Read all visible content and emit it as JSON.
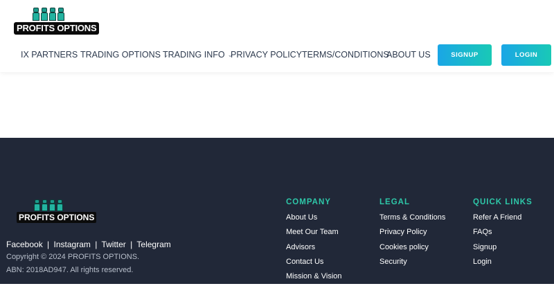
{
  "header": {
    "logo_text": "PROFITS OPTIONS",
    "nav": [
      {
        "label": "IX PARTNERS",
        "has_dropdown": false
      },
      {
        "label": "TRADING OPTIONS",
        "has_dropdown": true
      },
      {
        "label": "TRADING INFO",
        "has_dropdown": true
      },
      {
        "label": "PRIVACY POLICY",
        "has_dropdown": false
      },
      {
        "label": "TERMS/CONDITIONS",
        "has_dropdown": false
      },
      {
        "label": "ABOUT US",
        "has_dropdown": false
      }
    ],
    "signup_label": "SIGNUP",
    "login_label": "LOGIN"
  },
  "footer": {
    "logo_text": "PROFITS OPTIONS",
    "social": [
      "Facebook",
      "Instagram",
      "Twitter",
      "Telegram"
    ],
    "social_separator": "|",
    "copyright": "Copyright © 2024 PROFITS OPTIONS.",
    "abn": "ABN: 2018AD947. All rights reserved.",
    "columns": [
      {
        "title": "COMPANY",
        "links": [
          "About Us",
          "Meet Our Team",
          "Advisors",
          "Contact Us",
          "Mission & Vision"
        ]
      },
      {
        "title": "LEGAL",
        "links": [
          "Terms & Conditions",
          "Privacy Policy",
          "Cookies policy",
          "Security"
        ]
      },
      {
        "title": "QUICK LINKS",
        "links": [
          "Refer A Friend",
          "FAQs",
          "Signup",
          "Login"
        ]
      }
    ]
  },
  "colors": {
    "footer_bg": "#212838",
    "accent_teal": "#2ec7a8",
    "button_gradient_start": "#1aa6e6",
    "button_gradient_end": "#19c9b6",
    "nav_text": "#2d3a4e"
  },
  "icons": {
    "dropdown": "chevron-down-icon"
  }
}
